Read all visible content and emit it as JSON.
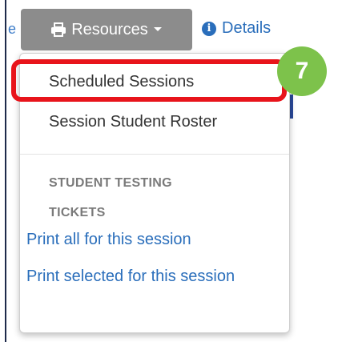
{
  "toolbar": {
    "resources_label": "Resources",
    "details_label": "Details"
  },
  "dropdown": {
    "items": [
      {
        "label": "Scheduled Sessions"
      },
      {
        "label": "Session Student Roster"
      }
    ],
    "section_header": "STUDENT TESTING TICKETS",
    "links": [
      {
        "label": "Print all for this session"
      },
      {
        "label": "Print selected for this session"
      }
    ]
  },
  "annotation": {
    "step_number": "7",
    "highlight_color": "#e8141b",
    "badge_color": "#7dc24b"
  },
  "colors": {
    "button_bg": "#8c8c8c",
    "link": "#2a6ebb"
  }
}
